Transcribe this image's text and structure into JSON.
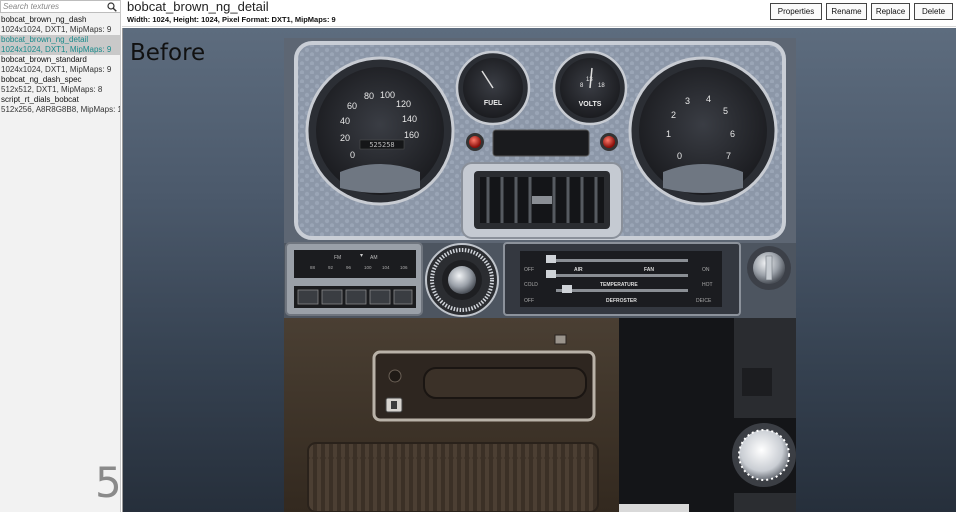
{
  "sidebar": {
    "search_placeholder": "Search textures",
    "items": [
      {
        "name": "bobcat_brown_ng_dash",
        "meta": "1024x1024, DXT1, MipMaps: 9"
      },
      {
        "name": "bobcat_brown_ng_detail",
        "meta": "1024x1024, DXT1, MipMaps: 9"
      },
      {
        "name": "bobcat_brown_standard",
        "meta": "1024x1024, DXT1, MipMaps: 9"
      },
      {
        "name": "bobcat_ng_dash_spec",
        "meta": "512x512, DXT1, MipMaps: 8"
      },
      {
        "name": "script_rt_dials_bobcat",
        "meta": "512x256, A8R8G8B8, MipMaps: 1"
      }
    ],
    "selected_index": 1,
    "page_number": "5"
  },
  "header": {
    "title": "bobcat_brown_ng_detail",
    "info": "Width: 1024, Height: 1024, Pixel Format: DXT1, MipMaps: 9",
    "buttons": {
      "properties": "Properties",
      "rename": "Rename",
      "replace": "Replace",
      "delete": "Delete"
    }
  },
  "viewport": {
    "label": "Before",
    "texture": {
      "speedo_numbers": [
        "0",
        "20",
        "40",
        "60",
        "80",
        "100",
        "120",
        "140",
        "160"
      ],
      "odometer": "525258",
      "fuel_label": "FUEL",
      "volts_label": "VOLTS",
      "volts_numbers": [
        "8",
        "13",
        "18"
      ],
      "tach_numbers": [
        "0",
        "1",
        "2",
        "3",
        "4",
        "5",
        "6",
        "7"
      ],
      "radio_bands": [
        "FM",
        "AM"
      ],
      "radio_freqs": [
        "88",
        "92",
        "96",
        "100",
        "104",
        "106"
      ],
      "hvac_labels": {
        "off": "OFF",
        "air": "AIR",
        "fan": "FAN",
        "on": "ON",
        "cold": "COLD",
        "temperature": "TEMPERATURE",
        "hot": "HOT",
        "defroster": "DEFROSTER",
        "deice": "DEICE"
      }
    }
  },
  "colors": {
    "selected_text": "#1a8a8a",
    "selected_bg": "#c9c9c9",
    "viewport_top": "#5d6c7e",
    "viewport_bottom": "#262f3b"
  }
}
